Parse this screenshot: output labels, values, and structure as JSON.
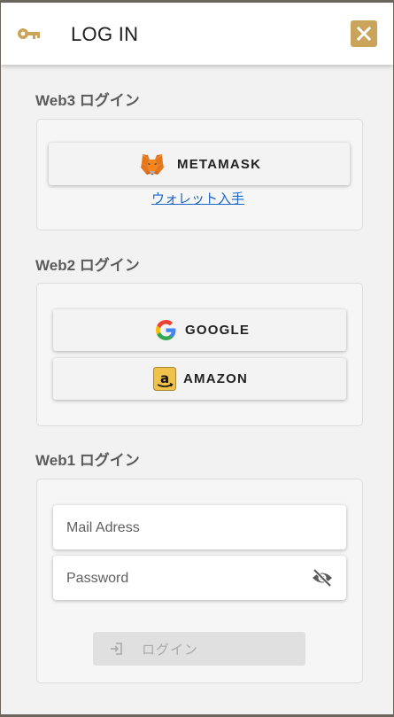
{
  "dialog": {
    "title": "LOG IN",
    "key_icon": "key-icon",
    "close_icon": "close-icon",
    "accent_color": "#c9a45a"
  },
  "web3": {
    "title": "Web3 ログイン",
    "metamask_label": "METAMASK",
    "metamask_icon": "metamask-fox-icon",
    "wallet_link": "ウォレット入手"
  },
  "web2": {
    "title": "Web2 ログイン",
    "google_label": "GOOGLE",
    "google_icon": "google-icon",
    "amazon_label": "AMAZON",
    "amazon_icon": "amazon-icon"
  },
  "web1": {
    "title": "Web1 ログイン",
    "mail_placeholder": "Mail Adress",
    "password_placeholder": "Password",
    "visibility_icon": "eye-off-icon",
    "login_label": "ログイン",
    "login_icon": "login-icon"
  }
}
